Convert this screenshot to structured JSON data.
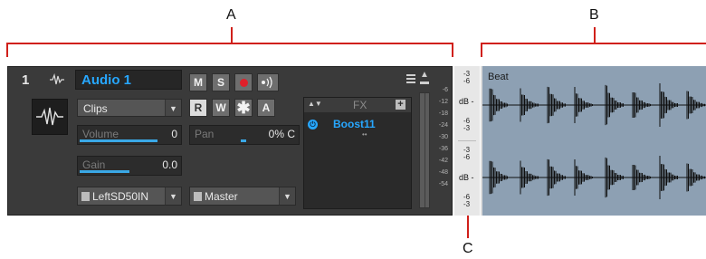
{
  "callouts": {
    "a": "A",
    "b": "B",
    "c": "C"
  },
  "track": {
    "number": "1",
    "name": "Audio 1",
    "input_mode": "Clips",
    "volume": {
      "label": "Volume",
      "value": "0",
      "level": 0.78
    },
    "pan": {
      "label": "Pan",
      "value": "0% C",
      "level": 0.5
    },
    "gain": {
      "label": "Gain",
      "value": "0.0",
      "level": 0.5
    },
    "input": "LeftSD50IN",
    "output": "Master",
    "buttons": {
      "mute": "M",
      "solo": "S",
      "read": "R",
      "write": "W",
      "arm": "A"
    },
    "fx": {
      "label": "FX",
      "plugin": "Boost11",
      "plugin_sub": "••"
    },
    "meter_scale": [
      "-6",
      "-12",
      "-18",
      "-24",
      "-30",
      "-36",
      "-42",
      "-48",
      "-54"
    ]
  },
  "db_strip": {
    "top_upper": "-3",
    "top_lower": "-6",
    "label_1": "dB",
    "mid_upper": "-6",
    "mid_lower": "-3",
    "mid2_upper": "-3",
    "mid2_lower": "-6",
    "label_2": "dB",
    "bot_upper": "-6",
    "bot_lower": "-3"
  },
  "clip": {
    "name": "Beat"
  },
  "colors": {
    "accent": "#27a7ff",
    "record": "#e0202a",
    "bracket": "#d0201a",
    "clip_bg": "#8da0b3",
    "waveform": "#0f0f0f"
  },
  "icons": {
    "track_type": "waveform-icon",
    "track_icon": "waveform-icon",
    "menu": "menu-icon",
    "collapse": "chevron-up-icon",
    "power": "power-icon",
    "add_fx": "plus-icon",
    "arm": "asterisk-icon",
    "echo": "input-echo-icon"
  }
}
